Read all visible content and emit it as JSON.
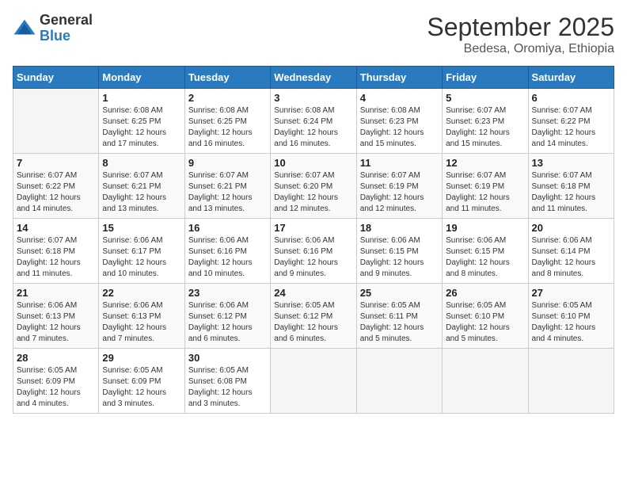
{
  "logo": {
    "general": "General",
    "blue": "Blue"
  },
  "title": "September 2025",
  "subtitle": "Bedesa, Oromiya, Ethiopia",
  "days_header": [
    "Sunday",
    "Monday",
    "Tuesday",
    "Wednesday",
    "Thursday",
    "Friday",
    "Saturday"
  ],
  "weeks": [
    [
      {
        "num": "",
        "detail": ""
      },
      {
        "num": "1",
        "detail": "Sunrise: 6:08 AM\nSunset: 6:25 PM\nDaylight: 12 hours\nand 17 minutes."
      },
      {
        "num": "2",
        "detail": "Sunrise: 6:08 AM\nSunset: 6:25 PM\nDaylight: 12 hours\nand 16 minutes."
      },
      {
        "num": "3",
        "detail": "Sunrise: 6:08 AM\nSunset: 6:24 PM\nDaylight: 12 hours\nand 16 minutes."
      },
      {
        "num": "4",
        "detail": "Sunrise: 6:08 AM\nSunset: 6:23 PM\nDaylight: 12 hours\nand 15 minutes."
      },
      {
        "num": "5",
        "detail": "Sunrise: 6:07 AM\nSunset: 6:23 PM\nDaylight: 12 hours\nand 15 minutes."
      },
      {
        "num": "6",
        "detail": "Sunrise: 6:07 AM\nSunset: 6:22 PM\nDaylight: 12 hours\nand 14 minutes."
      }
    ],
    [
      {
        "num": "7",
        "detail": "Sunrise: 6:07 AM\nSunset: 6:22 PM\nDaylight: 12 hours\nand 14 minutes."
      },
      {
        "num": "8",
        "detail": "Sunrise: 6:07 AM\nSunset: 6:21 PM\nDaylight: 12 hours\nand 13 minutes."
      },
      {
        "num": "9",
        "detail": "Sunrise: 6:07 AM\nSunset: 6:21 PM\nDaylight: 12 hours\nand 13 minutes."
      },
      {
        "num": "10",
        "detail": "Sunrise: 6:07 AM\nSunset: 6:20 PM\nDaylight: 12 hours\nand 12 minutes."
      },
      {
        "num": "11",
        "detail": "Sunrise: 6:07 AM\nSunset: 6:19 PM\nDaylight: 12 hours\nand 12 minutes."
      },
      {
        "num": "12",
        "detail": "Sunrise: 6:07 AM\nSunset: 6:19 PM\nDaylight: 12 hours\nand 11 minutes."
      },
      {
        "num": "13",
        "detail": "Sunrise: 6:07 AM\nSunset: 6:18 PM\nDaylight: 12 hours\nand 11 minutes."
      }
    ],
    [
      {
        "num": "14",
        "detail": "Sunrise: 6:07 AM\nSunset: 6:18 PM\nDaylight: 12 hours\nand 11 minutes."
      },
      {
        "num": "15",
        "detail": "Sunrise: 6:06 AM\nSunset: 6:17 PM\nDaylight: 12 hours\nand 10 minutes."
      },
      {
        "num": "16",
        "detail": "Sunrise: 6:06 AM\nSunset: 6:16 PM\nDaylight: 12 hours\nand 10 minutes."
      },
      {
        "num": "17",
        "detail": "Sunrise: 6:06 AM\nSunset: 6:16 PM\nDaylight: 12 hours\nand 9 minutes."
      },
      {
        "num": "18",
        "detail": "Sunrise: 6:06 AM\nSunset: 6:15 PM\nDaylight: 12 hours\nand 9 minutes."
      },
      {
        "num": "19",
        "detail": "Sunrise: 6:06 AM\nSunset: 6:15 PM\nDaylight: 12 hours\nand 8 minutes."
      },
      {
        "num": "20",
        "detail": "Sunrise: 6:06 AM\nSunset: 6:14 PM\nDaylight: 12 hours\nand 8 minutes."
      }
    ],
    [
      {
        "num": "21",
        "detail": "Sunrise: 6:06 AM\nSunset: 6:13 PM\nDaylight: 12 hours\nand 7 minutes."
      },
      {
        "num": "22",
        "detail": "Sunrise: 6:06 AM\nSunset: 6:13 PM\nDaylight: 12 hours\nand 7 minutes."
      },
      {
        "num": "23",
        "detail": "Sunrise: 6:06 AM\nSunset: 6:12 PM\nDaylight: 12 hours\nand 6 minutes."
      },
      {
        "num": "24",
        "detail": "Sunrise: 6:05 AM\nSunset: 6:12 PM\nDaylight: 12 hours\nand 6 minutes."
      },
      {
        "num": "25",
        "detail": "Sunrise: 6:05 AM\nSunset: 6:11 PM\nDaylight: 12 hours\nand 5 minutes."
      },
      {
        "num": "26",
        "detail": "Sunrise: 6:05 AM\nSunset: 6:10 PM\nDaylight: 12 hours\nand 5 minutes."
      },
      {
        "num": "27",
        "detail": "Sunrise: 6:05 AM\nSunset: 6:10 PM\nDaylight: 12 hours\nand 4 minutes."
      }
    ],
    [
      {
        "num": "28",
        "detail": "Sunrise: 6:05 AM\nSunset: 6:09 PM\nDaylight: 12 hours\nand 4 minutes."
      },
      {
        "num": "29",
        "detail": "Sunrise: 6:05 AM\nSunset: 6:09 PM\nDaylight: 12 hours\nand 3 minutes."
      },
      {
        "num": "30",
        "detail": "Sunrise: 6:05 AM\nSunset: 6:08 PM\nDaylight: 12 hours\nand 3 minutes."
      },
      {
        "num": "",
        "detail": ""
      },
      {
        "num": "",
        "detail": ""
      },
      {
        "num": "",
        "detail": ""
      },
      {
        "num": "",
        "detail": ""
      }
    ]
  ]
}
